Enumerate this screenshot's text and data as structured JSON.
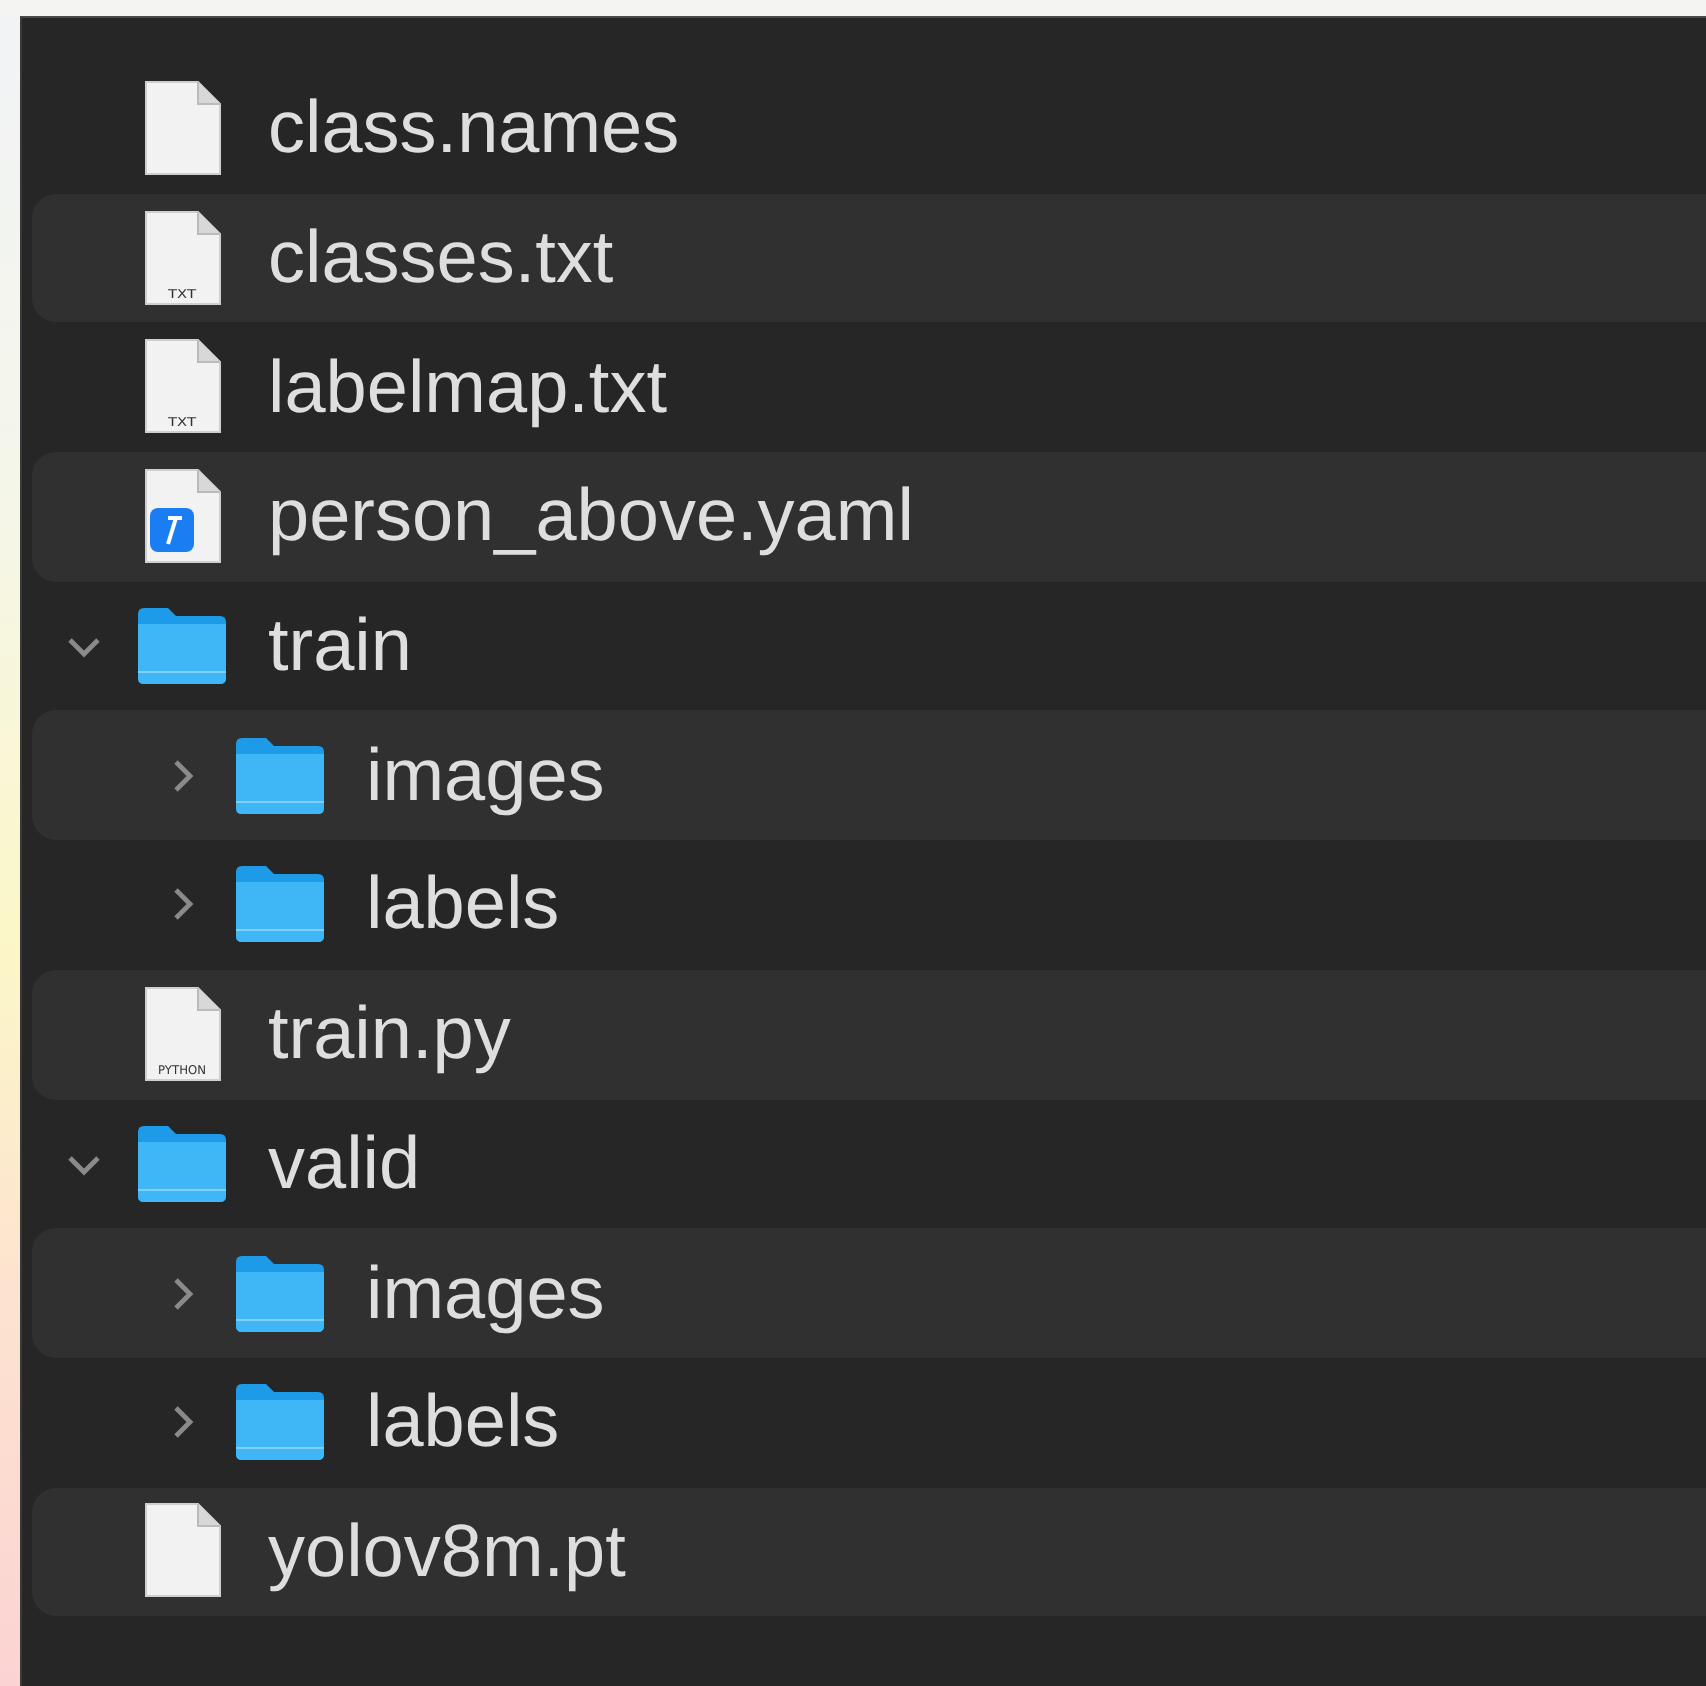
{
  "files": [
    {
      "name": "class.names",
      "kind": "blank"
    },
    {
      "name": "classes.txt",
      "kind": "doc",
      "icon_label": "TXT"
    },
    {
      "name": "labelmap.txt",
      "kind": "doc",
      "icon_label": "TXT"
    },
    {
      "name": "person_above.yaml",
      "kind": "yaml"
    },
    {
      "name": "train",
      "kind": "folder",
      "expanded": true,
      "children": [
        {
          "name": "images",
          "kind": "folder",
          "expanded": false
        },
        {
          "name": "labels",
          "kind": "folder",
          "expanded": false
        }
      ]
    },
    {
      "name": "train.py",
      "kind": "doc",
      "icon_label": "PYTHON"
    },
    {
      "name": "valid",
      "kind": "folder",
      "expanded": true,
      "children": [
        {
          "name": "images",
          "kind": "folder",
          "expanded": false
        },
        {
          "name": "labels",
          "kind": "folder",
          "expanded": false
        }
      ]
    },
    {
      "name": "yolov8m.pt",
      "kind": "blank"
    }
  ]
}
